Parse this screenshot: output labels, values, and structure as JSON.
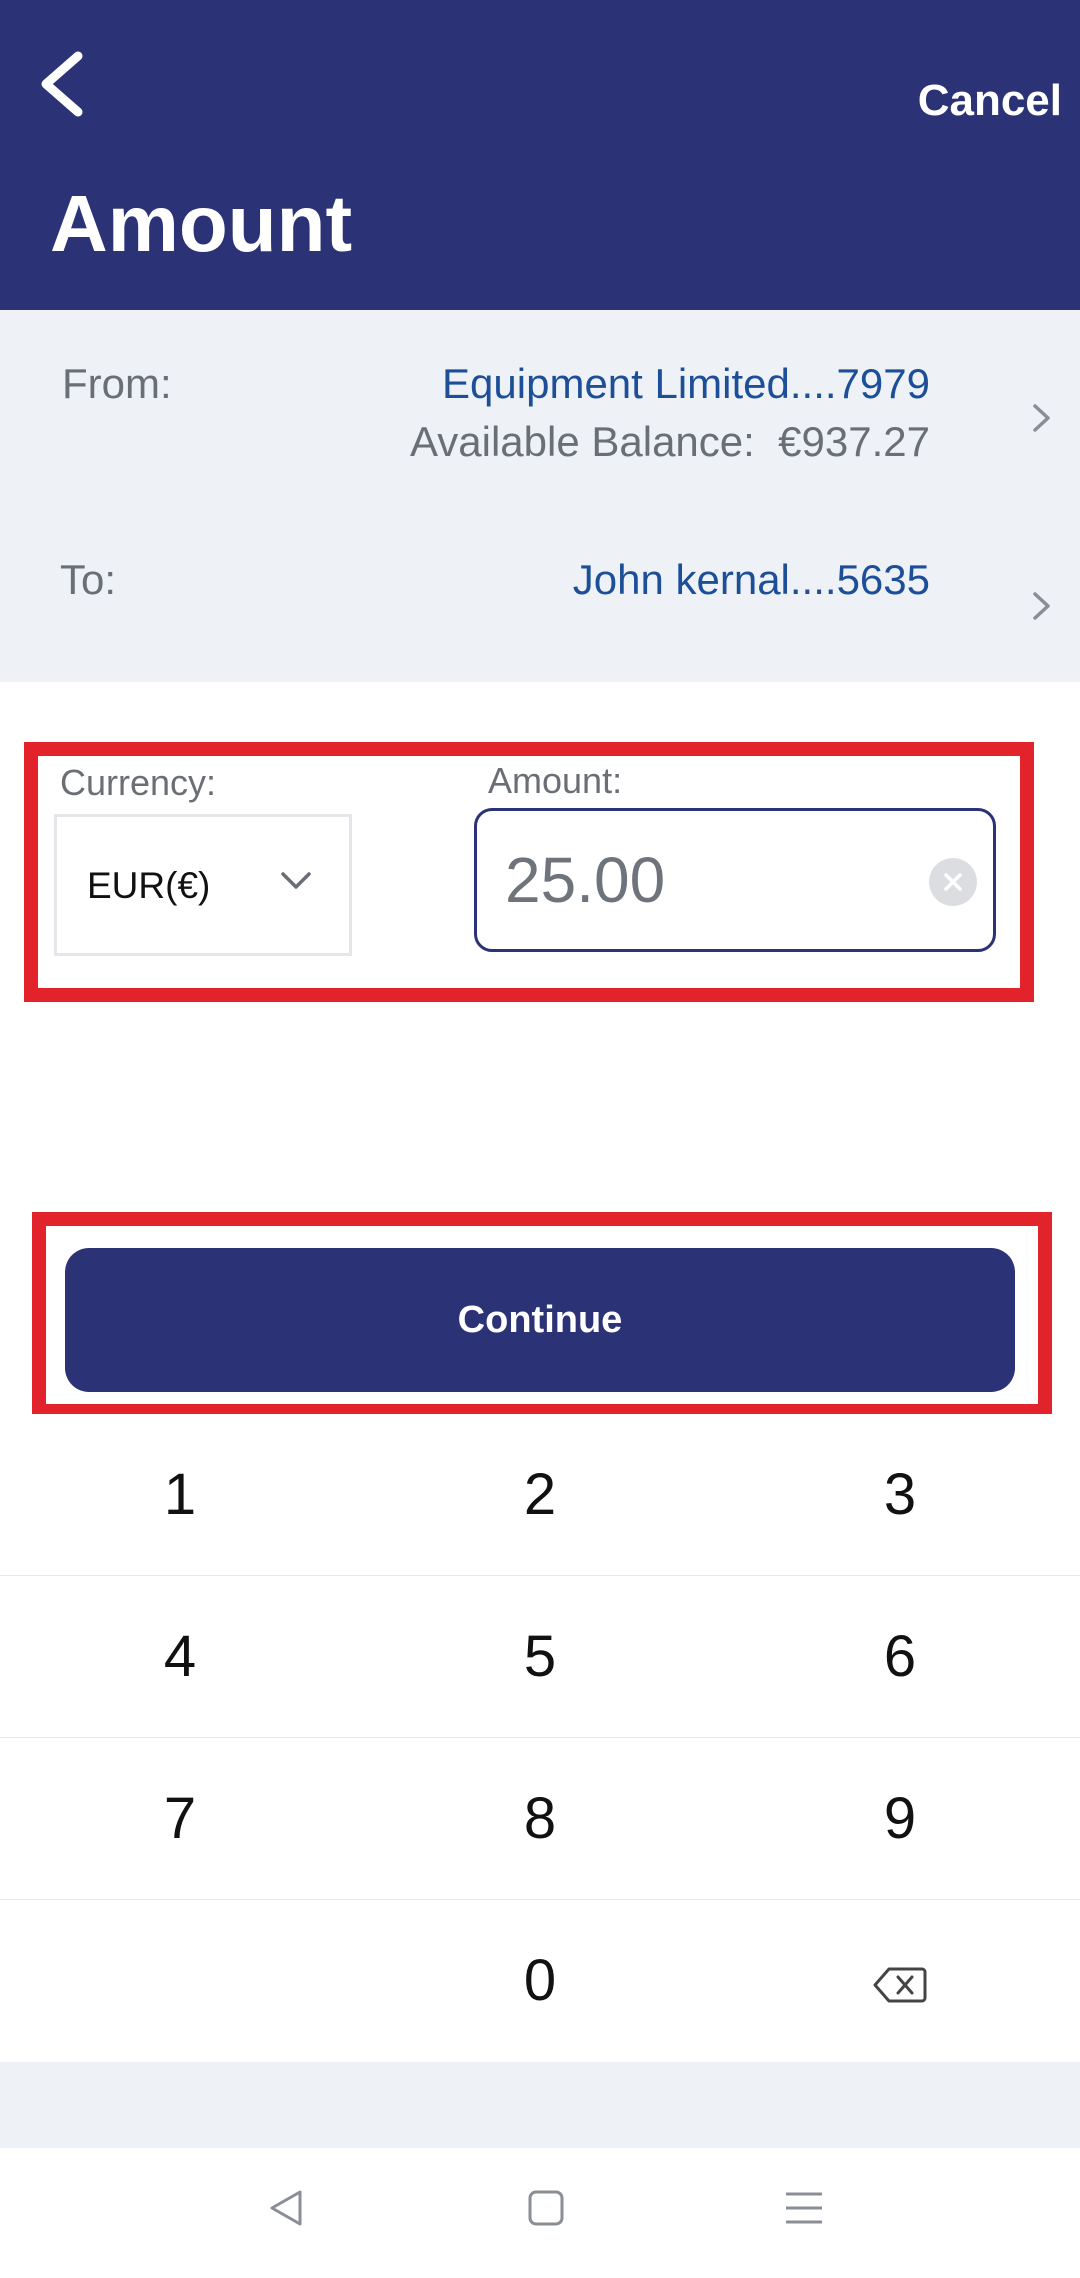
{
  "header": {
    "title": "Amount",
    "cancel_label": "Cancel"
  },
  "accounts": {
    "from": {
      "label": "From:",
      "name": "Equipment Limited....7979",
      "balance_label": "Available Balance:",
      "balance_value": "€937.27"
    },
    "to": {
      "label": "To:",
      "name": "John kernal....5635"
    }
  },
  "form": {
    "currency_label": "Currency:",
    "currency_value": "EUR(€)",
    "amount_label": "Amount:",
    "amount_value": "25.00"
  },
  "continue_label": "Continue",
  "keypad": {
    "keys": [
      "1",
      "2",
      "3",
      "4",
      "5",
      "6",
      "7",
      "8",
      "9",
      "0"
    ]
  },
  "icons": {
    "back": "chevron-left-icon",
    "account_chevron": "chevron-right-icon",
    "currency_dropdown": "chevron-down-icon",
    "clear": "close-circle-icon",
    "backspace": "backspace-icon",
    "nav_back": "triangle-back-icon",
    "nav_home": "square-home-icon",
    "nav_menu": "menu-lines-icon"
  },
  "colors": {
    "primary": "#2b3276",
    "link": "#1d4f99",
    "highlight": "#e3232b",
    "panel_bg": "#eef2f6"
  }
}
